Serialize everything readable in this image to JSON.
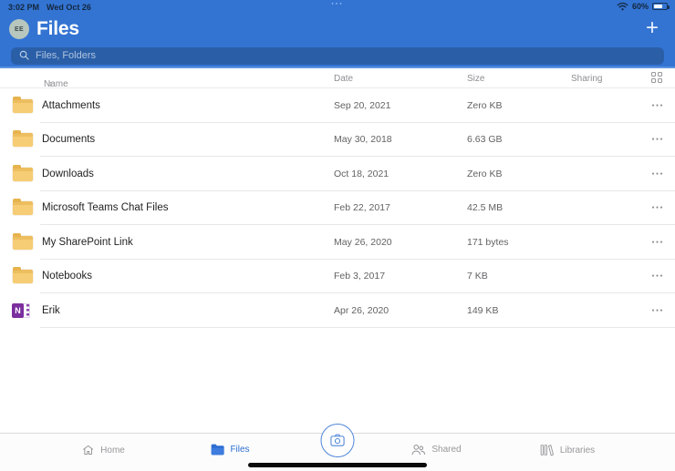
{
  "status_bar": {
    "time": "3:02 PM",
    "date": "Wed Oct 26",
    "battery": "60%"
  },
  "header": {
    "avatar_initials": "EE",
    "title": "Files"
  },
  "search": {
    "placeholder": "Files, Folders"
  },
  "table": {
    "columns": {
      "name": "Name",
      "date": "Date",
      "size": "Size",
      "sharing": "Sharing"
    },
    "rows": [
      {
        "name": "Attachments",
        "date": "Sep 20, 2021",
        "size": "Zero KB",
        "icon": "folder"
      },
      {
        "name": "Documents",
        "date": "May 30, 2018",
        "size": "6.63 GB",
        "icon": "folder"
      },
      {
        "name": "Downloads",
        "date": "Oct 18, 2021",
        "size": "Zero KB",
        "icon": "folder"
      },
      {
        "name": "Microsoft Teams Chat Files",
        "date": "Feb 22, 2017",
        "size": "42.5 MB",
        "icon": "folder"
      },
      {
        "name": "My SharePoint Link",
        "date": "May 26, 2020",
        "size": "171 bytes",
        "icon": "folder"
      },
      {
        "name": "Notebooks",
        "date": "Feb 3, 2017",
        "size": "7 KB",
        "icon": "folder"
      },
      {
        "name": "Erik",
        "date": "Apr 26, 2020",
        "size": "149 KB",
        "icon": "onenote"
      }
    ]
  },
  "tab_bar": {
    "tabs": [
      {
        "label": "Home"
      },
      {
        "label": "Files"
      },
      {
        "label": "Shared"
      },
      {
        "label": "Libraries"
      }
    ]
  },
  "icons": {
    "sort_asc": "↑",
    "more": "●●●",
    "plus": "+",
    "onenote_letter": "N",
    "multitask_dots": "●●●"
  },
  "colors": {
    "header_blue": "#3374D3",
    "search_bg": "#2A5FA8",
    "accent_blue": "#2D6FD2",
    "folder_yellow": "#F6CD74",
    "onenote_purple": "#7B2E9E"
  }
}
